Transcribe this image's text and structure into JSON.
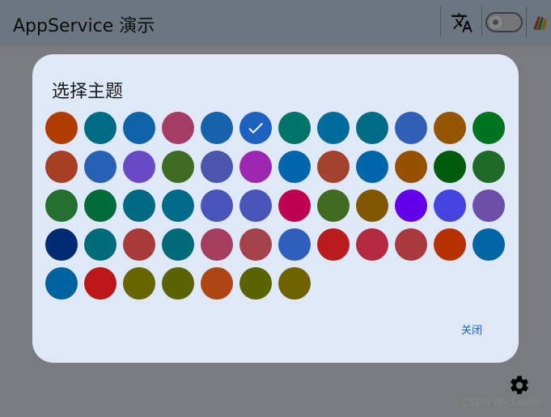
{
  "appbar": {
    "title": "AppService 演示",
    "translate_icon": "translate-icon",
    "theme_switch_icon": "brightness-icon",
    "palette_icon": "palette-icon"
  },
  "dialog": {
    "title": "选择主题",
    "close_label": "关闭",
    "selected_index": 5,
    "swatches": [
      "#b03c00",
      "#006b85",
      "#0f63a8",
      "#a43c63",
      "#1763ab",
      "#1e62c0",
      "#00736a",
      "#006c9c",
      "#006b85",
      "#325fb6",
      "#945500",
      "#00731f",
      "#a63f24",
      "#2861b3",
      "#6a4ac4",
      "#3f6c22",
      "#4b56af",
      "#9c27b0",
      "#0066ac",
      "#a3422f",
      "#0066a9",
      "#965100",
      "#005c0d",
      "#1d6b26",
      "#237030",
      "#006b3b",
      "#006a84",
      "#006a8a",
      "#4a55b9",
      "#4a55b8",
      "#bf004f",
      "#406b20",
      "#805700",
      "#6200ea",
      "#4544df",
      "#6b4fa8",
      "#002b70",
      "#006b7a",
      "#a83a3a",
      "#006a78",
      "#a53d5e",
      "#a3424a",
      "#2f5ebd",
      "#bb1b1f",
      "#b42a40",
      "#a7393f",
      "#b73100",
      "#0065a4",
      "#00639f",
      "#bd1717",
      "#676500",
      "#5b6300",
      "#ad4613",
      "#596400",
      "#6f6300"
    ]
  },
  "footer": {
    "settings_icon": "gear-icon",
    "watermark": "CSDN @jcLee95"
  }
}
